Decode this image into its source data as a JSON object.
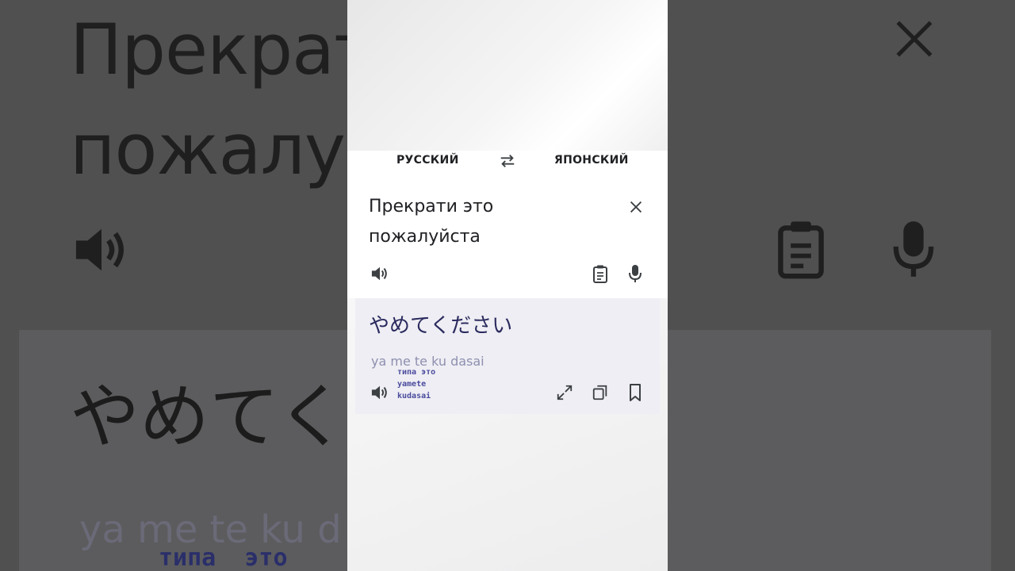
{
  "background": {
    "source_text": "Прекрати\nпожалуй",
    "translation_text": "やめてく",
    "romaji_text": "ya me te ku d",
    "overlay_text": "типа  это"
  },
  "languages": {
    "source": "РУССКИЙ",
    "target": "ЯПОНСКИЙ"
  },
  "source_card": {
    "text": "Прекрати это пожалуйста"
  },
  "result_card": {
    "text": "やめてください",
    "romaji": "ya me te ku dasai",
    "overlay_caption": "типа это\nyamete\nkudasai"
  },
  "icons": {
    "swap": "swap-arrows-icon",
    "close": "close-icon",
    "speaker": "speaker-icon",
    "clipboard": "clipboard-icon",
    "mic": "microphone-icon",
    "expand": "expand-icon",
    "copy": "copy-icon",
    "bookmark": "bookmark-icon"
  },
  "colors": {
    "accent_text": "#2b2a5e",
    "romaji": "#8f8fb0",
    "result_bg": "#eeeef4"
  }
}
